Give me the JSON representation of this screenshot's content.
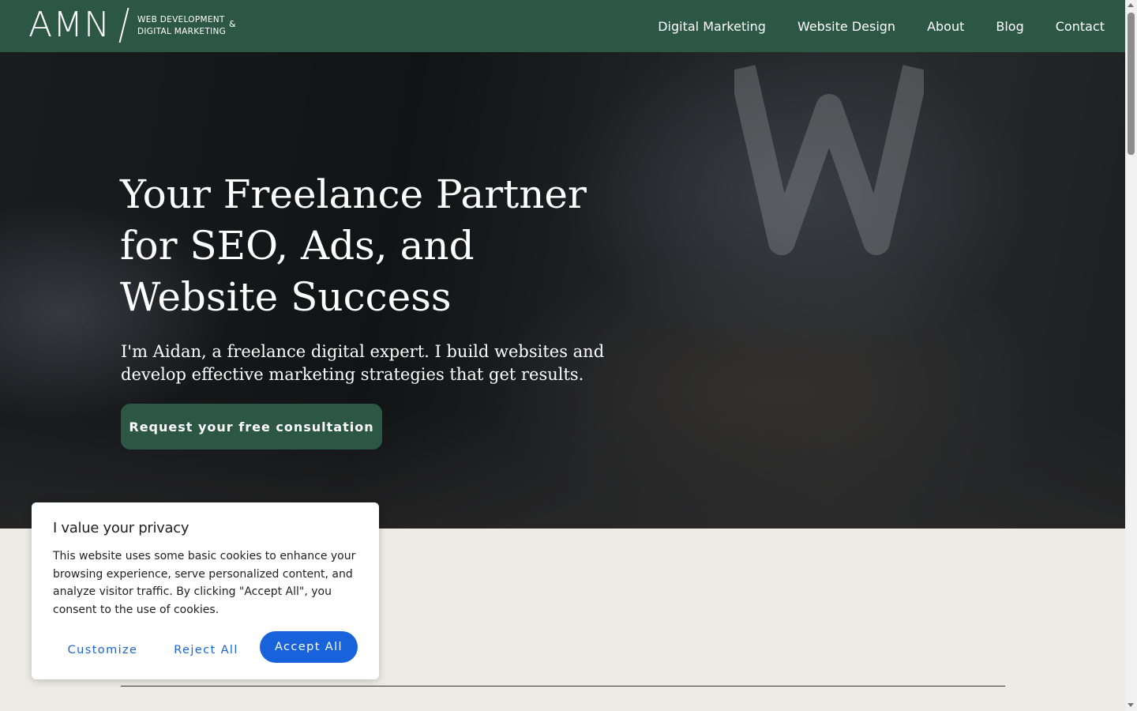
{
  "header": {
    "logo": {
      "main": "AMN",
      "line1": "WEB DEVELOPMENT",
      "line2": "DIGITAL MARKETING",
      "amp": "&"
    },
    "nav": [
      {
        "label": "Digital Marketing"
      },
      {
        "label": "Website Design"
      },
      {
        "label": "About"
      },
      {
        "label": "Blog"
      },
      {
        "label": "Contact"
      }
    ]
  },
  "hero": {
    "title": "Your Freelance Partner for SEO, Ads, and Website Success",
    "subtitle": "I'm Aidan, a freelance digital expert. I build websites and develop effective marketing strategies that get results.",
    "cta_label": "Request your free consultation"
  },
  "cookie_banner": {
    "title": "I value your privacy",
    "text": "This website uses some basic cookies to enhance your browsing experience, serve personalized content, and analyze visitor traffic. By clicking \"Accept All\", you consent to the use of cookies.",
    "customize_label": "Customize",
    "reject_label": "Reject All",
    "accept_label": "Accept All"
  },
  "colors": {
    "brand_green": "#2b5744",
    "accept_blue": "#1863dc",
    "page_bg": "#eeebe4"
  }
}
